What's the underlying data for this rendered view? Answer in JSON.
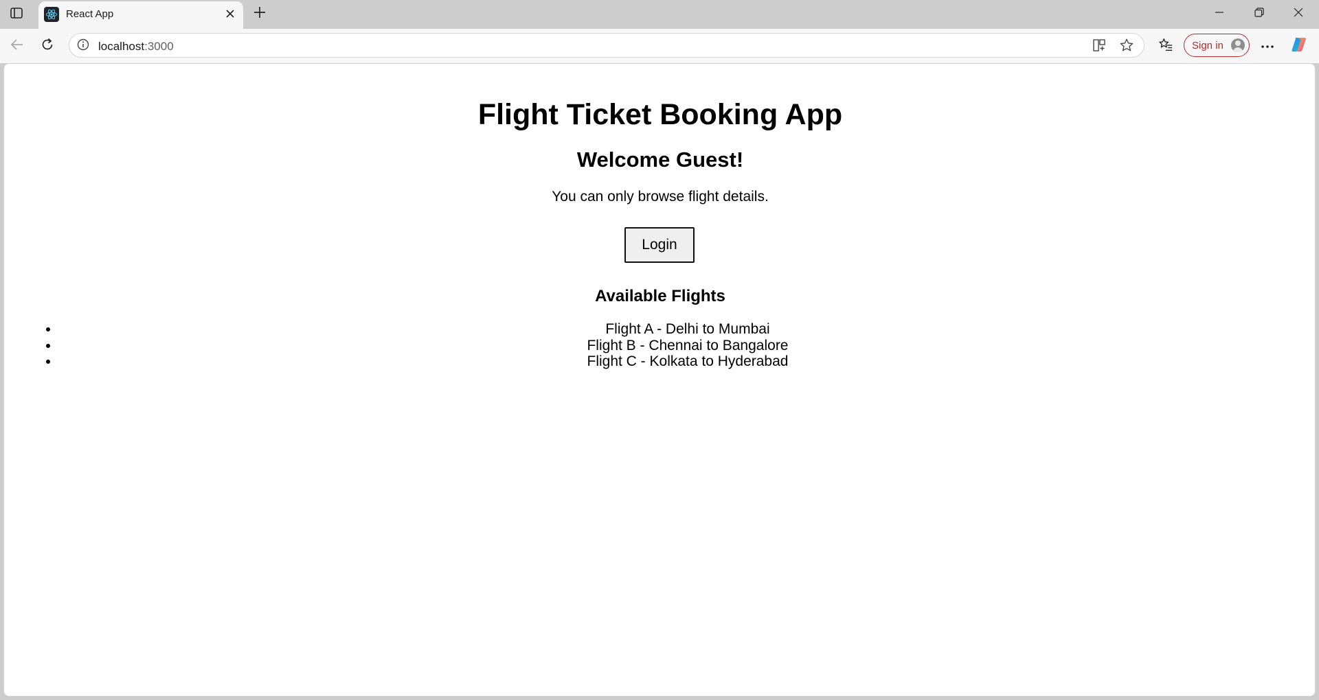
{
  "browser": {
    "tab": {
      "title": "React App",
      "favicon": "react-logo-icon"
    },
    "address": {
      "host": "localhost",
      "port": ":3000"
    },
    "sign_in_label": "Sign in",
    "icons": {
      "tab_actions": "tab-actions-icon",
      "close_tab": "close-icon",
      "new_tab": "plus-icon",
      "back": "arrow-left-icon",
      "refresh": "refresh-icon",
      "site_info": "info-icon",
      "split_screen": "split-screen-icon",
      "favorite": "star-icon",
      "favorites": "favorites-icon",
      "more": "more-icon",
      "copilot": "copilot-icon"
    },
    "colors": {
      "sign_in_accent": "#b02a2a",
      "tab_strip": "#cdcdcd"
    }
  },
  "app": {
    "title": "Flight Ticket Booking App",
    "welcome": "Welcome Guest!",
    "info": "You can only browse flight details.",
    "login_button": "Login",
    "flights_heading": "Available Flights",
    "flights": [
      "Flight A - Delhi to Mumbai",
      "Flight B - Chennai to Bangalore",
      "Flight C - Kolkata to Hyderabad"
    ]
  }
}
